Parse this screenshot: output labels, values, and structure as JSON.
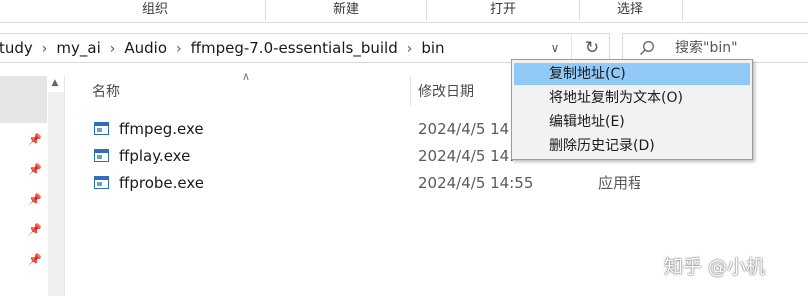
{
  "ribbon": {
    "groups": [
      "组织",
      "新建",
      "打开",
      "选择"
    ]
  },
  "address": {
    "breadcrumbs": [
      "tudy",
      "my_ai",
      "Audio",
      "ffmpeg-7.0-essentials_build",
      "bin"
    ]
  },
  "search": {
    "placeholder": "搜索\"bin\""
  },
  "columns": {
    "name": "名称",
    "date": "修改日期"
  },
  "files": [
    {
      "name": "ffmpeg.exe",
      "date": "2024/4/5 14:",
      "type": ""
    },
    {
      "name": "ffplay.exe",
      "date": "2024/4/5 14:",
      "type": ""
    },
    {
      "name": "ffprobe.exe",
      "date": "2024/4/5 14:55",
      "type": "应用程"
    }
  ],
  "context_menu": {
    "items": [
      "复制地址(C)",
      "将地址复制为文本(O)",
      "编辑地址(E)",
      "删除历史记录(D)"
    ],
    "highlighted_index": 0
  },
  "watermark": {
    "text": "知乎 @小机"
  },
  "colors": {
    "highlight": "#91c9f7",
    "file_icon": "#2e6fb7",
    "selected_nav": "#e5e5e5"
  }
}
